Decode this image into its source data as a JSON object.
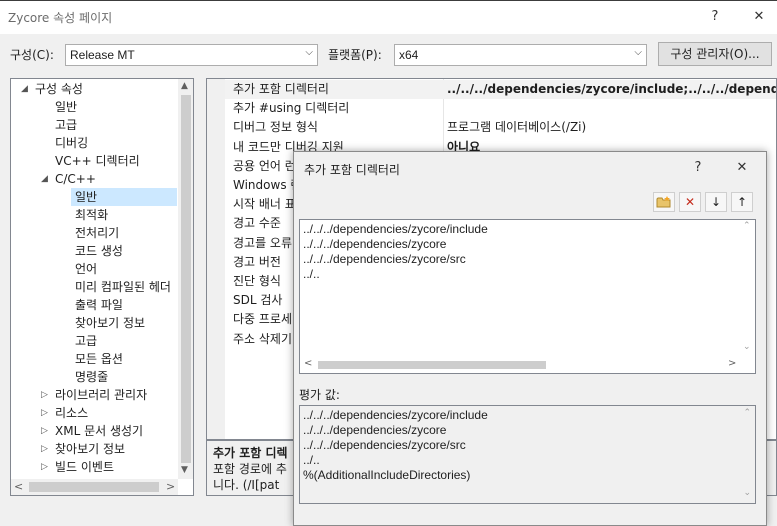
{
  "window": {
    "title": "Zycore 속성 페이지",
    "help_glyph": "?",
    "close_glyph": "✕"
  },
  "config": {
    "config_label": "구성(C):",
    "config_value": "Release MT",
    "platform_label": "플랫폼(P):",
    "platform_value": "x64",
    "manager_button": "구성 관리자(O)..."
  },
  "tree": {
    "items": [
      {
        "label": "구성 속성",
        "expander": "◢"
      },
      {
        "label": "일반"
      },
      {
        "label": "고급"
      },
      {
        "label": "디버깅"
      },
      {
        "label": "VC++ 디렉터리"
      },
      {
        "label": "C/C++",
        "expander": "◢"
      },
      {
        "label": "일반"
      },
      {
        "label": "최적화"
      },
      {
        "label": "전처리기"
      },
      {
        "label": "코드 생성"
      },
      {
        "label": "언어"
      },
      {
        "label": "미리 컴파일된 헤더"
      },
      {
        "label": "출력 파일"
      },
      {
        "label": "찾아보기 정보"
      },
      {
        "label": "고급"
      },
      {
        "label": "모든 옵션"
      },
      {
        "label": "명령줄"
      },
      {
        "label": "라이브러리 관리자",
        "expander": "▷"
      },
      {
        "label": "리소스",
        "expander": "▷"
      },
      {
        "label": "XML 문서 생성기",
        "expander": "▷"
      },
      {
        "label": "찾아보기 정보",
        "expander": "▷"
      },
      {
        "label": "빌드 이벤트",
        "expander": "▷"
      }
    ]
  },
  "grid": {
    "rows": [
      {
        "name": "추가 포함 디렉터리",
        "value": "../../../dependencies/zycore/include;../../../dependencies/z"
      },
      {
        "name": "추가 #using 디렉터리",
        "value": ""
      },
      {
        "name": "디버그 정보 형식",
        "value": "프로그램 데이터베이스(/Zi)"
      },
      {
        "name": "내 코드만 디버깅 지원",
        "value": "아니요"
      },
      {
        "name": "공용 언어 런",
        "value": ""
      },
      {
        "name": "Windows 런",
        "value": ""
      },
      {
        "name": "시작 배너 표",
        "value": ""
      },
      {
        "name": "경고 수준",
        "value": ""
      },
      {
        "name": "경고를 오류",
        "value": ""
      },
      {
        "name": "경고 버전",
        "value": ""
      },
      {
        "name": "진단 형식",
        "value": ""
      },
      {
        "name": "SDL 검사",
        "value": ""
      },
      {
        "name": "다중 프로세",
        "value": ""
      },
      {
        "name": "주소 삭제기",
        "value": ""
      }
    ]
  },
  "description": {
    "title": "추가 포함 디렉",
    "line1": "포함 경로에 추",
    "line2": "니다.     (/I[pat"
  },
  "dialog": {
    "title": "추가 포함 디렉터리",
    "help_glyph": "?",
    "close_glyph": "✕",
    "entries": [
      "../../../dependencies/zycore/include",
      "../../../dependencies/zycore",
      "../../../dependencies/zycore/src",
      "../.."
    ],
    "eval_label": "평가 값:",
    "eval_entries": [
      "../../../dependencies/zycore/include",
      "../../../dependencies/zycore",
      "../../../dependencies/zycore/src",
      "../..",
      "%(AdditionalIncludeDirectories)"
    ]
  }
}
